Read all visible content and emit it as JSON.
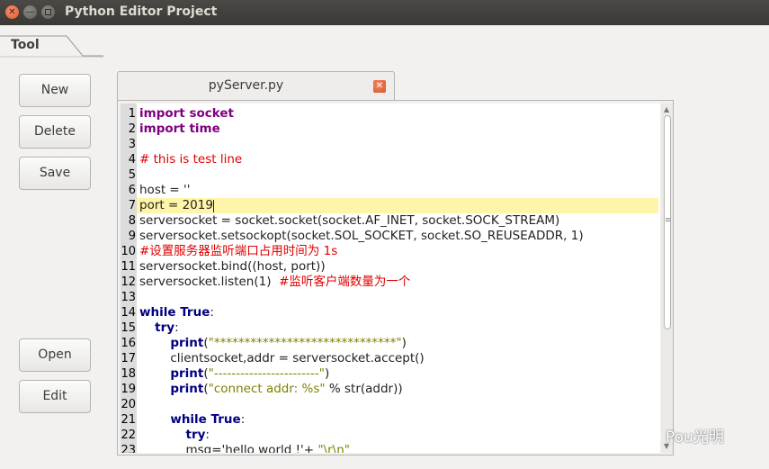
{
  "window": {
    "title": "Python Editor Project",
    "close_glyph": "✕",
    "minimize_glyph": "—"
  },
  "tool_tab": {
    "label": "Tool"
  },
  "buttons": {
    "new": "New",
    "delete": "Delete",
    "save": "Save",
    "open": "Open",
    "edit": "Edit"
  },
  "editor_tab": {
    "label": "pyServer.py",
    "close_glyph": "✕"
  },
  "editor": {
    "line_numbers": [
      "1",
      "2",
      "3",
      "4",
      "5",
      "6",
      "7",
      "8",
      "9",
      "10",
      "11",
      "12",
      "13",
      "14",
      "15",
      "16",
      "17",
      "18",
      "19",
      "20",
      "21",
      "22",
      "23"
    ],
    "lines": [
      {
        "segments": [
          {
            "text": "import socket",
            "style": "kw"
          }
        ]
      },
      {
        "segments": [
          {
            "text": "import time",
            "style": "kw"
          }
        ]
      },
      {
        "segments": []
      },
      {
        "segments": [
          {
            "text": "# this is test line",
            "style": "cm"
          }
        ]
      },
      {
        "segments": []
      },
      {
        "segments": [
          {
            "text": "host = ''",
            "style": "nm"
          }
        ]
      },
      {
        "segments": [
          {
            "text": "port = 2019",
            "style": "nm"
          }
        ]
      },
      {
        "segments": [
          {
            "text": "serversocket = socket.socket(socket.AF_INET, socket.SOCK_STREAM)",
            "style": "nm"
          }
        ]
      },
      {
        "segments": [
          {
            "text": "serversocket.setsockopt(socket.SOL_SOCKET, socket.SO_REUSEADDR, 1)",
            "style": "nm"
          }
        ]
      },
      {
        "segments": [
          {
            "text": "#设置服务器监听端口占用时间为 1s",
            "style": "cm"
          }
        ]
      },
      {
        "segments": [
          {
            "text": "serversocket.bind((host, port))",
            "style": "nm"
          }
        ]
      },
      {
        "segments": [
          {
            "text": "serversocket.listen(1)  ",
            "style": "nm"
          },
          {
            "text": "#监听客户端数量为一个",
            "style": "cm"
          }
        ]
      },
      {
        "segments": []
      },
      {
        "segments": [
          {
            "text": "while True",
            "style": "kw2"
          },
          {
            "text": ":",
            "style": "nm"
          }
        ]
      },
      {
        "segments": [
          {
            "text": "    ",
            "style": "nm"
          },
          {
            "text": "try",
            "style": "kw2"
          },
          {
            "text": ":",
            "style": "nm"
          }
        ]
      },
      {
        "segments": [
          {
            "text": "        ",
            "style": "nm"
          },
          {
            "text": "print",
            "style": "kw2"
          },
          {
            "text": "(",
            "style": "nm"
          },
          {
            "text": "\"******************************\"",
            "style": "st"
          },
          {
            "text": ")",
            "style": "nm"
          }
        ]
      },
      {
        "segments": [
          {
            "text": "        clientsocket,addr = serversocket.accept()",
            "style": "nm"
          }
        ]
      },
      {
        "segments": [
          {
            "text": "        ",
            "style": "nm"
          },
          {
            "text": "print",
            "style": "kw2"
          },
          {
            "text": "(",
            "style": "nm"
          },
          {
            "text": "\"------------------------\"",
            "style": "st"
          },
          {
            "text": ")",
            "style": "nm"
          }
        ]
      },
      {
        "segments": [
          {
            "text": "        ",
            "style": "nm"
          },
          {
            "text": "print",
            "style": "kw2"
          },
          {
            "text": "(",
            "style": "nm"
          },
          {
            "text": "\"connect addr: %s\"",
            "style": "st"
          },
          {
            "text": " % str(addr))",
            "style": "nm"
          }
        ]
      },
      {
        "segments": []
      },
      {
        "segments": [
          {
            "text": "        ",
            "style": "nm"
          },
          {
            "text": "while True",
            "style": "kw2"
          },
          {
            "text": ":",
            "style": "nm"
          }
        ]
      },
      {
        "segments": [
          {
            "text": "            ",
            "style": "nm"
          },
          {
            "text": "try",
            "style": "kw2"
          },
          {
            "text": ":",
            "style": "nm"
          }
        ]
      },
      {
        "segments": [
          {
            "text": "            msg='hello world !'+ ",
            "style": "nm"
          },
          {
            "text": "\"\\r\\n\"",
            "style": "st"
          }
        ]
      }
    ],
    "current_line": 7
  },
  "watermark": {
    "text": "Pou光明"
  },
  "colors": {
    "keyword": "#800080",
    "keyword_flow": "#000080",
    "comment": "#e00000",
    "string": "#7f7f00",
    "current_line": "#fff5a8",
    "gutter": "#dcdcdc"
  }
}
